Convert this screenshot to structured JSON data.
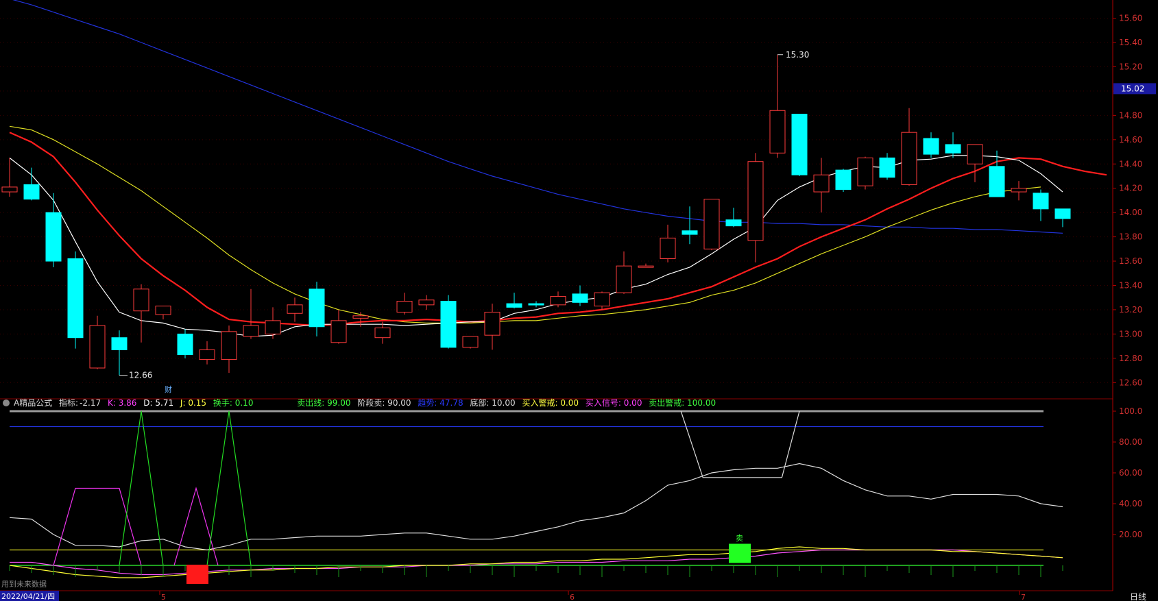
{
  "price_axis_ticks": [
    "15.60",
    "15.40",
    "15.20",
    "15.00",
    "14.80",
    "14.60",
    "14.40",
    "14.20",
    "14.00",
    "13.80",
    "13.60",
    "13.40",
    "13.20",
    "13.00",
    "12.80",
    "12.60"
  ],
  "current_price": "15.02",
  "indicator_axis_ticks": [
    "100.0",
    "80.00",
    "60.00",
    "40.00",
    "20.00"
  ],
  "annotations": {
    "high": "15.30",
    "low": "12.66",
    "cai": "财",
    "mai": "卖"
  },
  "indicator_bar": {
    "name": "A精品公式",
    "zhibiao_label": "指标:",
    "zhibiao": "-2.17",
    "k": "K: 3.86",
    "d": "D: 5.71",
    "j": "J: 0.15",
    "huanshou": "换手: 0.10",
    "maichuxian": "卖出线: 99.00",
    "jieduanmai": "阶段卖: 90.00",
    "qushi": "趋势: 47.78",
    "dibu": "底部: 10.00",
    "mairu_jingjie": "买入警戒: 0.00",
    "mairu_xinhao": "买入信号: 0.00",
    "maichu_jingjie": "卖出警戒: 100.00"
  },
  "bottom": {
    "date": "2022/04/21/四",
    "month_ticks": [
      "5",
      "6",
      "7"
    ],
    "period": "日线",
    "note": "用到未来数据"
  },
  "colors": {
    "up": "#ff3c3c",
    "down": "#00ffff",
    "ma5": "#ffffff",
    "ma10": "#ff1e1e",
    "ma20": "#dddd22",
    "ma60": "#2233dd",
    "grid": "#8b0000"
  },
  "chart_data": {
    "type": "candlestick",
    "y_range": [
      12.5,
      15.75
    ],
    "candles": [
      {
        "o": 14.17,
        "h": 14.45,
        "l": 14.13,
        "c": 14.21
      },
      {
        "o": 14.23,
        "h": 14.37,
        "l": 14.1,
        "c": 14.11
      },
      {
        "o": 14.0,
        "h": 14.16,
        "l": 13.55,
        "c": 13.6
      },
      {
        "o": 13.62,
        "h": 13.68,
        "l": 12.88,
        "c": 12.97
      },
      {
        "o": 12.72,
        "h": 13.15,
        "l": 12.71,
        "c": 13.07
      },
      {
        "o": 12.97,
        "h": 13.03,
        "l": 12.66,
        "c": 12.87
      },
      {
        "o": 13.19,
        "h": 13.41,
        "l": 12.93,
        "c": 13.37
      },
      {
        "o": 13.16,
        "h": 13.23,
        "l": 13.12,
        "c": 13.23
      },
      {
        "o": 13.0,
        "h": 13.04,
        "l": 12.8,
        "c": 12.83
      },
      {
        "o": 12.79,
        "h": 12.94,
        "l": 12.75,
        "c": 12.87
      },
      {
        "o": 12.79,
        "h": 13.07,
        "l": 12.68,
        "c": 13.02
      },
      {
        "o": 12.98,
        "h": 13.37,
        "l": 12.96,
        "c": 13.07
      },
      {
        "o": 13.0,
        "h": 13.22,
        "l": 12.96,
        "c": 13.11
      },
      {
        "o": 13.17,
        "h": 13.3,
        "l": 13.1,
        "c": 13.24
      },
      {
        "o": 13.37,
        "h": 13.43,
        "l": 12.98,
        "c": 13.06
      },
      {
        "o": 12.93,
        "h": 13.2,
        "l": 12.92,
        "c": 13.11
      },
      {
        "o": 13.13,
        "h": 13.18,
        "l": 13.06,
        "c": 13.15
      },
      {
        "o": 12.97,
        "h": 13.1,
        "l": 12.92,
        "c": 13.05
      },
      {
        "o": 13.18,
        "h": 13.34,
        "l": 13.16,
        "c": 13.27
      },
      {
        "o": 13.24,
        "h": 13.32,
        "l": 13.2,
        "c": 13.28
      },
      {
        "o": 13.27,
        "h": 13.32,
        "l": 12.88,
        "c": 12.89
      },
      {
        "o": 12.89,
        "h": 12.98,
        "l": 12.88,
        "c": 12.98
      },
      {
        "o": 12.99,
        "h": 13.25,
        "l": 12.87,
        "c": 13.18
      },
      {
        "o": 13.25,
        "h": 13.34,
        "l": 13.21,
        "c": 13.22
      },
      {
        "o": 13.25,
        "h": 13.27,
        "l": 13.22,
        "c": 13.24
      },
      {
        "o": 13.24,
        "h": 13.35,
        "l": 13.22,
        "c": 13.31
      },
      {
        "o": 13.33,
        "h": 13.4,
        "l": 13.23,
        "c": 13.26
      },
      {
        "o": 13.23,
        "h": 13.35,
        "l": 13.2,
        "c": 13.34
      },
      {
        "o": 13.34,
        "h": 13.68,
        "l": 13.33,
        "c": 13.56
      },
      {
        "o": 13.56,
        "h": 13.58,
        "l": 13.55,
        "c": 13.56
      },
      {
        "o": 13.62,
        "h": 13.9,
        "l": 13.59,
        "c": 13.79
      },
      {
        "o": 13.85,
        "h": 14.05,
        "l": 13.74,
        "c": 13.82
      },
      {
        "o": 13.7,
        "h": 14.11,
        "l": 13.69,
        "c": 14.11
      },
      {
        "o": 13.94,
        "h": 14.04,
        "l": 13.88,
        "c": 13.89
      },
      {
        "o": 13.77,
        "h": 14.49,
        "l": 13.59,
        "c": 14.42
      },
      {
        "o": 14.49,
        "h": 15.3,
        "l": 14.45,
        "c": 14.84
      },
      {
        "o": 14.81,
        "h": 14.81,
        "l": 14.3,
        "c": 14.31
      },
      {
        "o": 14.17,
        "h": 14.45,
        "l": 14.0,
        "c": 14.31
      },
      {
        "o": 14.35,
        "h": 14.36,
        "l": 14.17,
        "c": 14.19
      },
      {
        "o": 14.22,
        "h": 14.46,
        "l": 14.19,
        "c": 14.45
      },
      {
        "o": 14.45,
        "h": 14.49,
        "l": 14.27,
        "c": 14.29
      },
      {
        "o": 14.23,
        "h": 14.86,
        "l": 14.22,
        "c": 14.66
      },
      {
        "o": 14.61,
        "h": 14.66,
        "l": 14.45,
        "c": 14.48
      },
      {
        "o": 14.56,
        "h": 14.66,
        "l": 14.45,
        "c": 14.49
      },
      {
        "o": 14.4,
        "h": 14.55,
        "l": 14.25,
        "c": 14.56
      },
      {
        "o": 14.38,
        "h": 14.51,
        "l": 14.17,
        "c": 14.13
      },
      {
        "o": 14.17,
        "h": 14.26,
        "l": 14.1,
        "c": 14.2
      },
      {
        "o": 14.16,
        "h": 14.19,
        "l": 13.93,
        "c": 14.03
      },
      {
        "o": 14.03,
        "h": 14.03,
        "l": 13.88,
        "c": 13.95
      }
    ],
    "ma5": [
      14.45,
      14.37,
      14.25,
      14.12,
      14.0,
      13.85,
      13.68,
      13.5,
      13.35,
      13.22,
      13.12,
      13.05,
      13.03,
      13.02,
      13.02,
      13.01,
      13.01,
      13.03,
      13.04,
      13.06,
      13.06,
      13.05,
      13.02,
      12.99,
      12.98,
      13.0,
      13.05,
      13.08,
      13.12,
      13.14,
      13.15,
      13.14,
      13.13,
      13.12,
      13.12,
      13.13,
      13.16,
      13.2,
      13.25,
      13.29,
      13.33,
      13.36,
      13.4,
      13.45,
      13.51,
      13.58,
      13.63,
      13.7,
      13.76,
      13.84,
      13.93,
      14.04,
      14.17,
      14.25,
      14.31,
      14.35,
      14.38,
      14.39,
      14.41,
      14.43,
      14.44,
      14.46,
      14.45,
      14.43,
      14.42,
      14.4,
      14.38,
      14.37,
      14.35,
      14.33,
      14.31,
      14.3,
      14.28,
      14.26,
      14.23,
      14.2,
      14.17,
      14.14,
      14.12,
      14.1
    ],
    "note_ma": "moving averages defined per candle index",
    "ma5_pts": [
      14.45,
      14.31,
      14.1,
      13.76,
      13.43,
      13.18,
      13.11,
      13.09,
      13.04,
      13.03,
      13.01,
      12.98,
      12.99,
      13.06,
      13.08,
      13.08,
      13.08,
      13.08,
      13.07,
      13.08,
      13.09,
      13.1,
      13.1,
      13.17,
      13.2,
      13.25,
      13.28,
      13.3,
      13.37,
      13.41,
      13.49,
      13.55,
      13.66,
      13.78,
      13.88,
      14.1,
      14.21,
      14.29,
      14.34,
      14.38,
      14.37,
      14.43,
      14.44,
      14.47,
      14.47,
      14.46,
      14.43,
      14.32,
      14.17
    ],
    "ma10_pts": [
      14.66,
      14.58,
      14.46,
      14.25,
      14.02,
      13.81,
      13.62,
      13.48,
      13.36,
      13.22,
      13.12,
      13.1,
      13.09,
      13.08,
      13.07,
      13.08,
      13.1,
      13.11,
      13.11,
      13.12,
      13.11,
      13.1,
      13.11,
      13.13,
      13.14,
      13.17,
      13.18,
      13.2,
      13.23,
      13.26,
      13.29,
      13.34,
      13.39,
      13.47,
      13.55,
      13.62,
      13.72,
      13.8,
      13.87,
      13.94,
      14.03,
      14.11,
      14.2,
      14.28,
      14.34,
      14.42,
      14.45,
      14.44,
      14.38,
      14.34,
      14.31
    ],
    "ma20_pts": [
      14.71,
      14.68,
      14.6,
      14.5,
      14.4,
      14.29,
      14.18,
      14.05,
      13.92,
      13.79,
      13.65,
      13.53,
      13.42,
      13.33,
      13.26,
      13.2,
      13.16,
      13.12,
      13.1,
      13.09,
      13.09,
      13.09,
      13.1,
      13.11,
      13.11,
      13.13,
      13.15,
      13.16,
      13.18,
      13.2,
      13.23,
      13.26,
      13.32,
      13.36,
      13.42,
      13.5,
      13.58,
      13.66,
      13.73,
      13.8,
      13.88,
      13.95,
      14.02,
      14.08,
      14.13,
      14.17,
      14.19,
      14.21
    ],
    "ma60_pts": [
      15.76,
      15.71,
      15.65,
      15.59,
      15.53,
      15.47,
      15.4,
      15.33,
      15.26,
      15.19,
      15.12,
      15.05,
      14.98,
      14.91,
      14.84,
      14.77,
      14.7,
      14.63,
      14.56,
      14.49,
      14.42,
      14.36,
      14.3,
      14.25,
      14.2,
      14.15,
      14.11,
      14.07,
      14.03,
      14.0,
      13.97,
      13.95,
      13.93,
      13.92,
      13.92,
      13.91,
      13.91,
      13.9,
      13.9,
      13.89,
      13.88,
      13.88,
      13.87,
      13.87,
      13.86,
      13.86,
      13.85,
      13.84,
      13.83
    ]
  }
}
